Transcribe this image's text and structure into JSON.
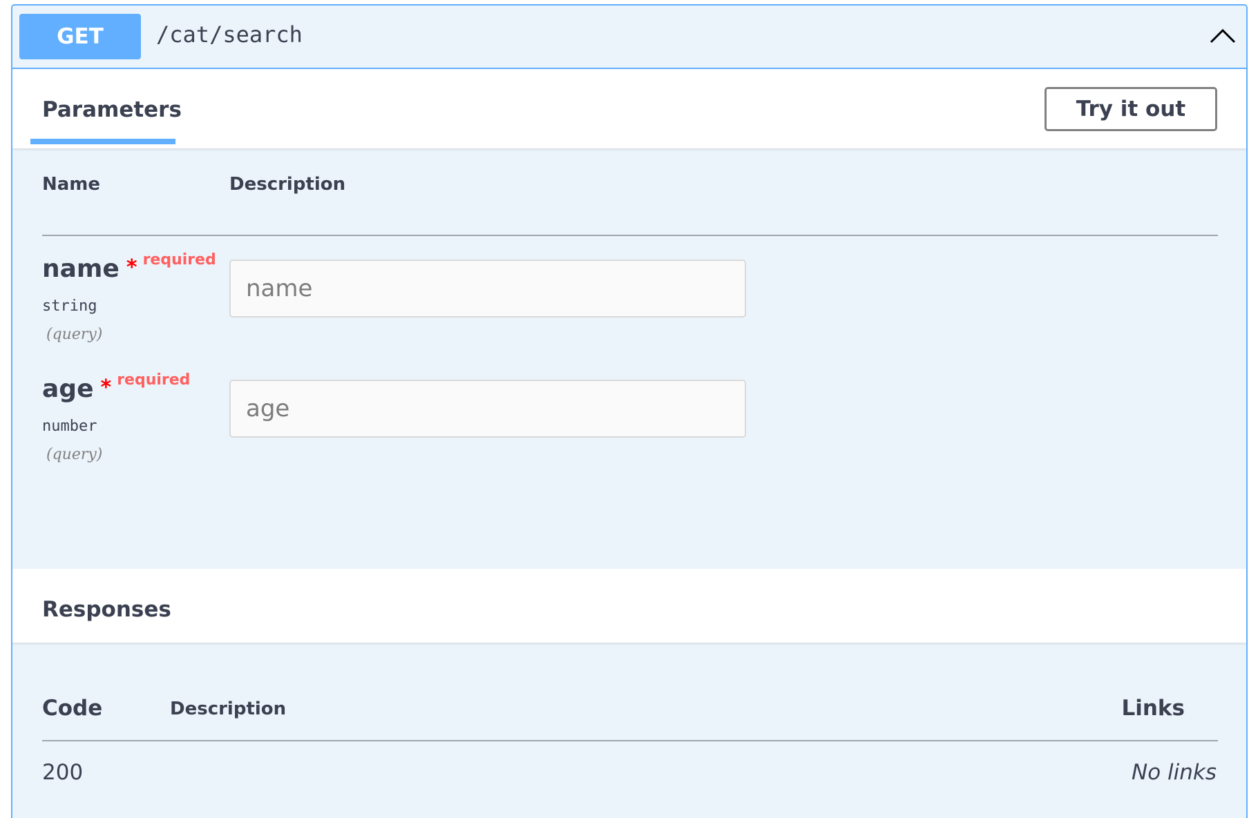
{
  "operation": {
    "method": "GET",
    "path": "/cat/search",
    "collapse_icon": "chevron-up-icon"
  },
  "parameters_section": {
    "tab_label": "Parameters",
    "try_button_label": "Try it out",
    "columns": {
      "name": "Name",
      "description": "Description"
    },
    "params": [
      {
        "name": "name",
        "required_mark": "*",
        "required_label": "required",
        "type": "string",
        "in": "(query)",
        "placeholder": "name"
      },
      {
        "name": "age",
        "required_mark": "*",
        "required_label": "required",
        "type": "number",
        "in": "(query)",
        "placeholder": "age"
      }
    ]
  },
  "responses_section": {
    "title": "Responses",
    "columns": {
      "code": "Code",
      "description": "Description",
      "links": "Links"
    },
    "rows": [
      {
        "code": "200",
        "description": "",
        "links": "No links"
      }
    ]
  },
  "colors": {
    "get_accent": "#61affe",
    "block_bg": "#ecf4fb",
    "required_star": "#ff0000",
    "required_label": "#ff6060",
    "text": "#3b4151"
  }
}
